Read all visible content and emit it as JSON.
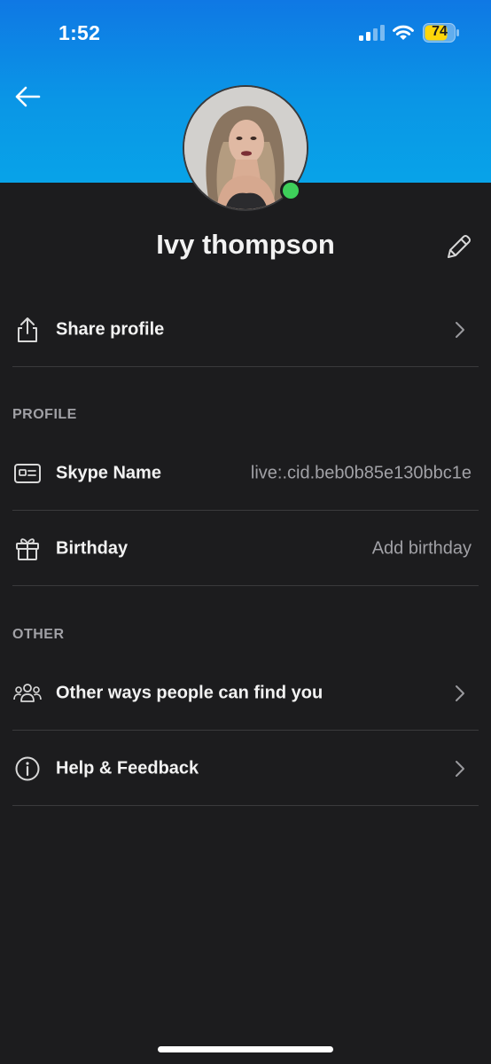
{
  "status_bar": {
    "time": "1:52",
    "battery": "74"
  },
  "profile": {
    "name": "Ivy thompson",
    "presence": "online"
  },
  "share": {
    "label": "Share profile"
  },
  "sections": {
    "profile_header": "PROFILE",
    "other_header": "OTHER"
  },
  "profile_rows": {
    "skype_name_label": "Skype Name",
    "skype_name_value": "live:.cid.beb0b85e130bbc1e",
    "birthday_label": "Birthday",
    "birthday_value": "Add birthday"
  },
  "other_rows": {
    "find_you_label": "Other ways people can find you",
    "help_label": "Help & Feedback"
  },
  "colors": {
    "header_top": "#0f78e4",
    "header_bottom": "#08a3e8",
    "background": "#1c1c1e",
    "presence_green": "#3ecf5a",
    "divider": "#3a3a3c",
    "secondary_text": "#a1a1a6"
  },
  "icons": {
    "back": "arrow-left-icon",
    "edit": "pencil-icon",
    "share": "share-icon",
    "skype_name": "id-card-icon",
    "birthday": "gift-icon",
    "find_you": "people-group-icon",
    "help": "info-icon",
    "chevron": "chevron-right-icon"
  }
}
